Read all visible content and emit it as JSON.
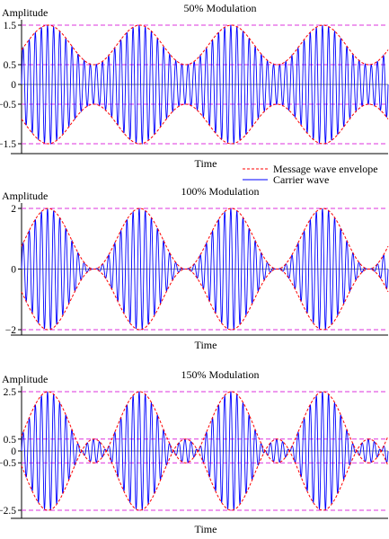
{
  "legend": {
    "items": [
      {
        "label": "Message wave envelope",
        "color": "#ff0000",
        "style": "dashed"
      },
      {
        "label": "Carrier wave",
        "color": "#0000ff",
        "style": "solid"
      }
    ],
    "placement": "right, below first panel"
  },
  "chart_data": [
    {
      "type": "line",
      "title": "50% Modulation",
      "xlabel": "Time",
      "ylabel": "Amplitude",
      "yticks": [
        1.5,
        0.5,
        0,
        -0.5,
        -1.5
      ],
      "ylim": [
        -1.5,
        1.5
      ],
      "modulation_index": 0.5,
      "envelope_periods": 4,
      "carrier_cycles": 60,
      "reference_lines": [
        1.5,
        0.5,
        -0.5,
        -1.5
      ],
      "series": [
        {
          "name": "Message wave envelope",
          "color": "#ff0000",
          "values": "envelope = ±(1 + 0.5·sin(ωm·t))"
        },
        {
          "name": "Carrier wave",
          "color": "#0000ff",
          "values": "(1 + 0.5·sin(ωm·t))·sin(ωc·t)"
        }
      ],
      "grid": false
    },
    {
      "type": "line",
      "title": "100% Modulation",
      "xlabel": "Time",
      "ylabel": "Amplitude",
      "yticks": [
        2,
        0,
        -2
      ],
      "ylim": [
        -2,
        2
      ],
      "modulation_index": 1.0,
      "envelope_periods": 4,
      "carrier_cycles": 60,
      "reference_lines": [
        2,
        -2
      ],
      "series": [
        {
          "name": "Message wave envelope",
          "color": "#ff0000",
          "values": "envelope = ±(1 + sin(ωm·t))"
        },
        {
          "name": "Carrier wave",
          "color": "#0000ff",
          "values": "(1 + sin(ωm·t))·sin(ωc·t)"
        }
      ],
      "grid": false
    },
    {
      "type": "line",
      "title": "150% Modulation",
      "xlabel": "Time",
      "ylabel": "Amplitude",
      "yticks": [
        2.5,
        0.5,
        0,
        -0.5,
        -2.5
      ],
      "ylim": [
        -2.5,
        2.5
      ],
      "modulation_index": 1.5,
      "envelope_periods": 4,
      "carrier_cycles": 60,
      "reference_lines": [
        2.5,
        0.5,
        -0.5,
        -2.5
      ],
      "series": [
        {
          "name": "Message wave envelope",
          "color": "#ff0000",
          "values": "envelope = ±(1 + 1.5·sin(ωm·t))"
        },
        {
          "name": "Carrier wave",
          "color": "#0000ff",
          "values": "(1 + 1.5·sin(ωm·t))·sin(ωc·t)"
        }
      ],
      "grid": false
    }
  ]
}
